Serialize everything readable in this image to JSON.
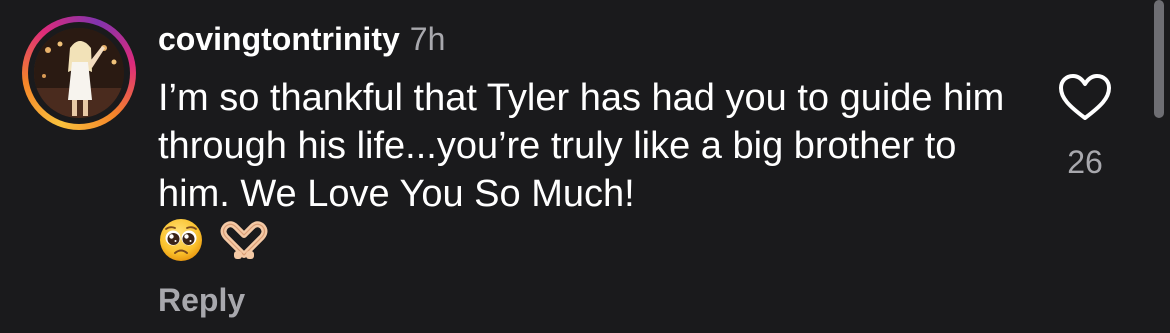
{
  "comment": {
    "username": "covingtontrinity",
    "time": "7h",
    "text": "I’m so thankful that Tyler has had you to guide him through his life...you’re truly like a big brother to him. We Love You So Much!",
    "emojis": [
      "pleading-face-icon",
      "heart-hands-icon"
    ],
    "reply_label": "Reply",
    "like_count": "26",
    "avatar_ring_colors": [
      "#f9c13d",
      "#f58529",
      "#dd2a7b",
      "#8134af"
    ]
  }
}
